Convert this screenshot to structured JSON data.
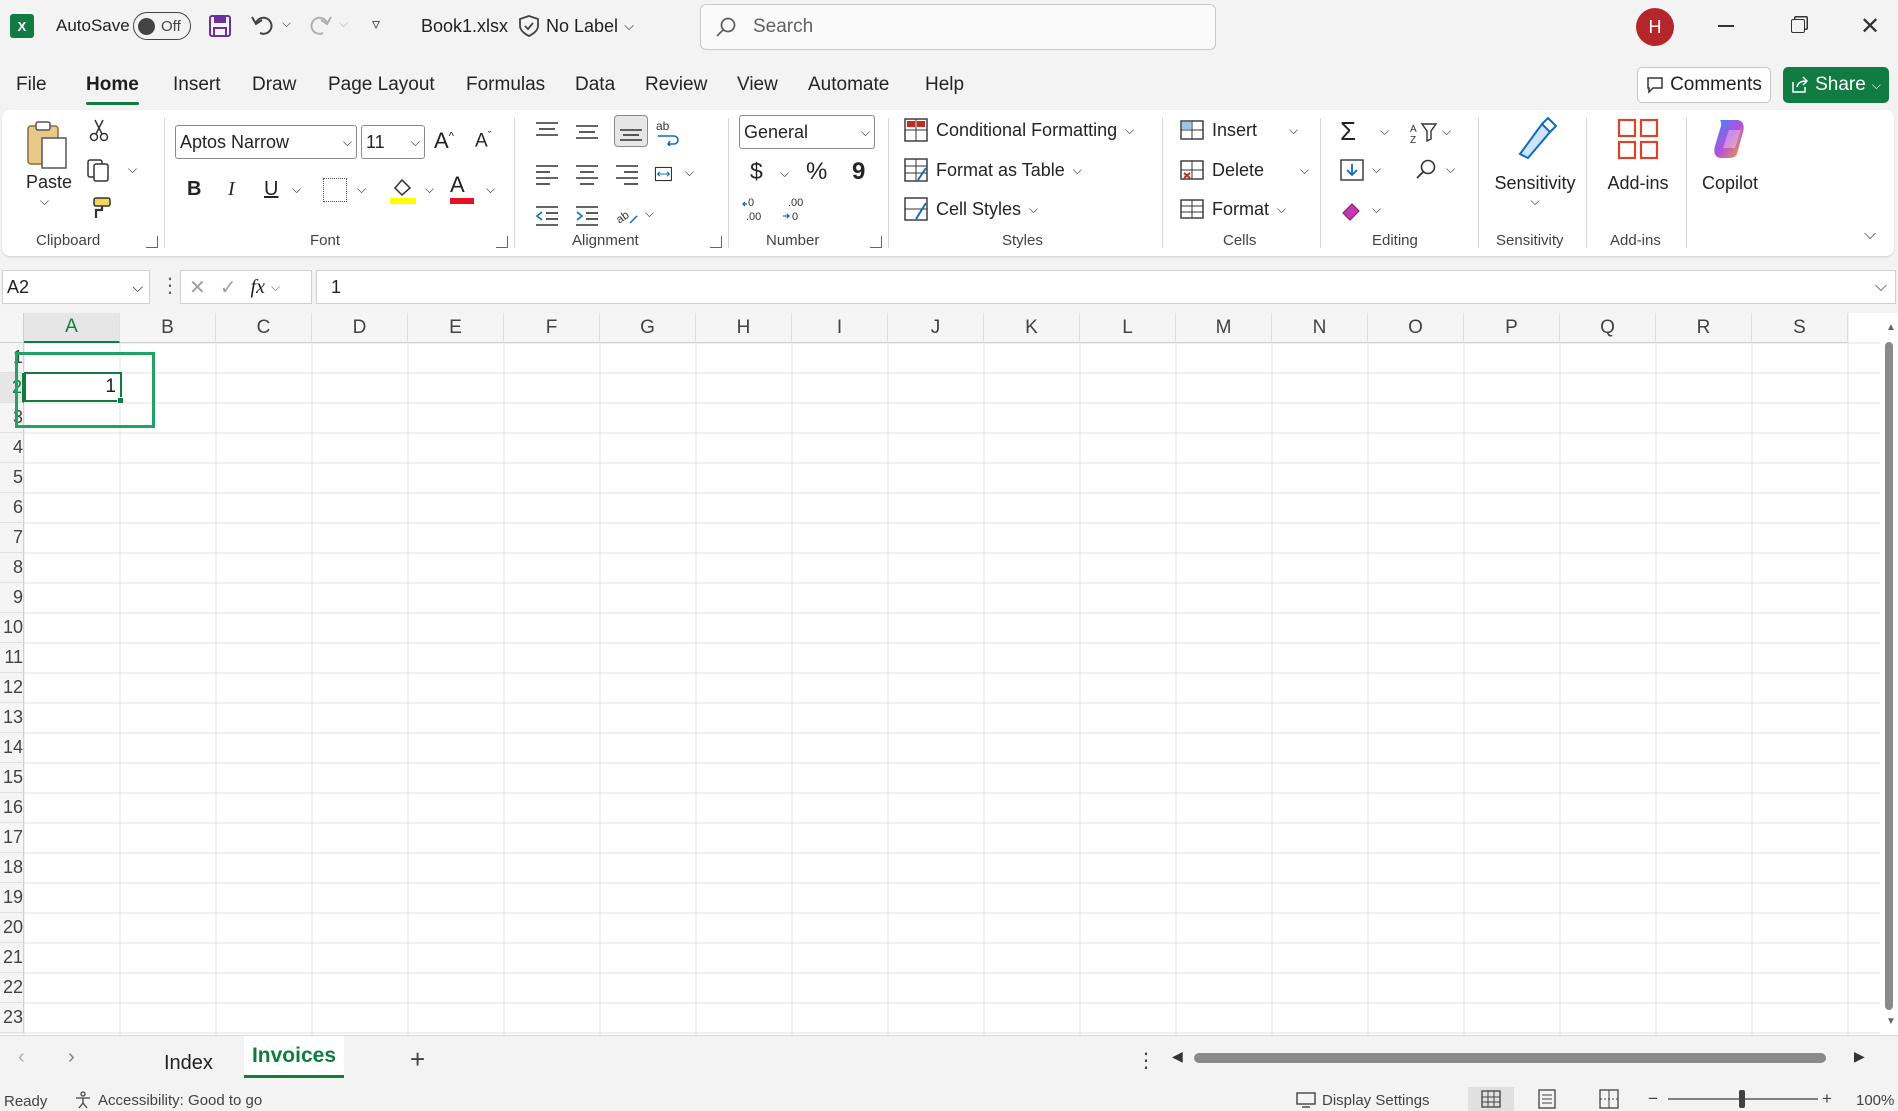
{
  "title_bar": {
    "autosave_label": "AutoSave",
    "autosave_state": "Off",
    "file_name": "Book1.xlsx",
    "sensitivity_label": "No Label",
    "search_placeholder": "Search",
    "avatar_initial": "H"
  },
  "menu_tabs": [
    "File",
    "Home",
    "Insert",
    "Draw",
    "Page Layout",
    "Formulas",
    "Data",
    "Review",
    "View",
    "Automate",
    "Help"
  ],
  "active_tab": "Home",
  "actions": {
    "comments": "Comments",
    "share": "Share"
  },
  "ribbon": {
    "clipboard": {
      "paste": "Paste",
      "label": "Clipboard"
    },
    "font": {
      "name": "Aptos Narrow",
      "size": "11",
      "bold": "B",
      "italic": "I",
      "underline": "U",
      "label": "Font"
    },
    "alignment": {
      "label": "Alignment"
    },
    "number": {
      "format": "General",
      "currency": "$",
      "percent": "%",
      "comma": "9",
      "label": "Number"
    },
    "styles": {
      "conditional": "Conditional Formatting",
      "format_table": "Format as Table",
      "cell_styles": "Cell Styles",
      "label": "Styles"
    },
    "cells": {
      "insert": "Insert",
      "delete": "Delete",
      "format": "Format",
      "label": "Cells"
    },
    "editing": {
      "label": "Editing"
    },
    "sensitivity": {
      "button": "Sensitivity",
      "label": "Sensitivity"
    },
    "addins": {
      "button": "Add-ins",
      "label": "Add-ins"
    },
    "copilot": {
      "button": "Copilot"
    }
  },
  "formula_bar": {
    "name_box": "A2",
    "fx": "fx",
    "value": "1"
  },
  "columns": [
    "A",
    "B",
    "C",
    "D",
    "E",
    "F",
    "G",
    "H",
    "I",
    "J",
    "K",
    "L",
    "M",
    "N",
    "O",
    "P",
    "Q",
    "R",
    "S"
  ],
  "rows": [
    "1",
    "2",
    "3",
    "4",
    "5",
    "6",
    "7",
    "8",
    "9",
    "10",
    "11",
    "12",
    "13",
    "14",
    "15",
    "16",
    "17",
    "18",
    "19",
    "20",
    "21",
    "22",
    "23"
  ],
  "cells": {
    "A2": "1"
  },
  "sheets": [
    "Index",
    "Invoices"
  ],
  "active_sheet": "Invoices",
  "status": {
    "ready": "Ready",
    "accessibility": "Accessibility: Good to go",
    "display_settings": "Display Settings",
    "zoom": "100%"
  },
  "colors": {
    "accent": "#107c41",
    "avatar": "#b4262a",
    "selection": "#21a366"
  }
}
